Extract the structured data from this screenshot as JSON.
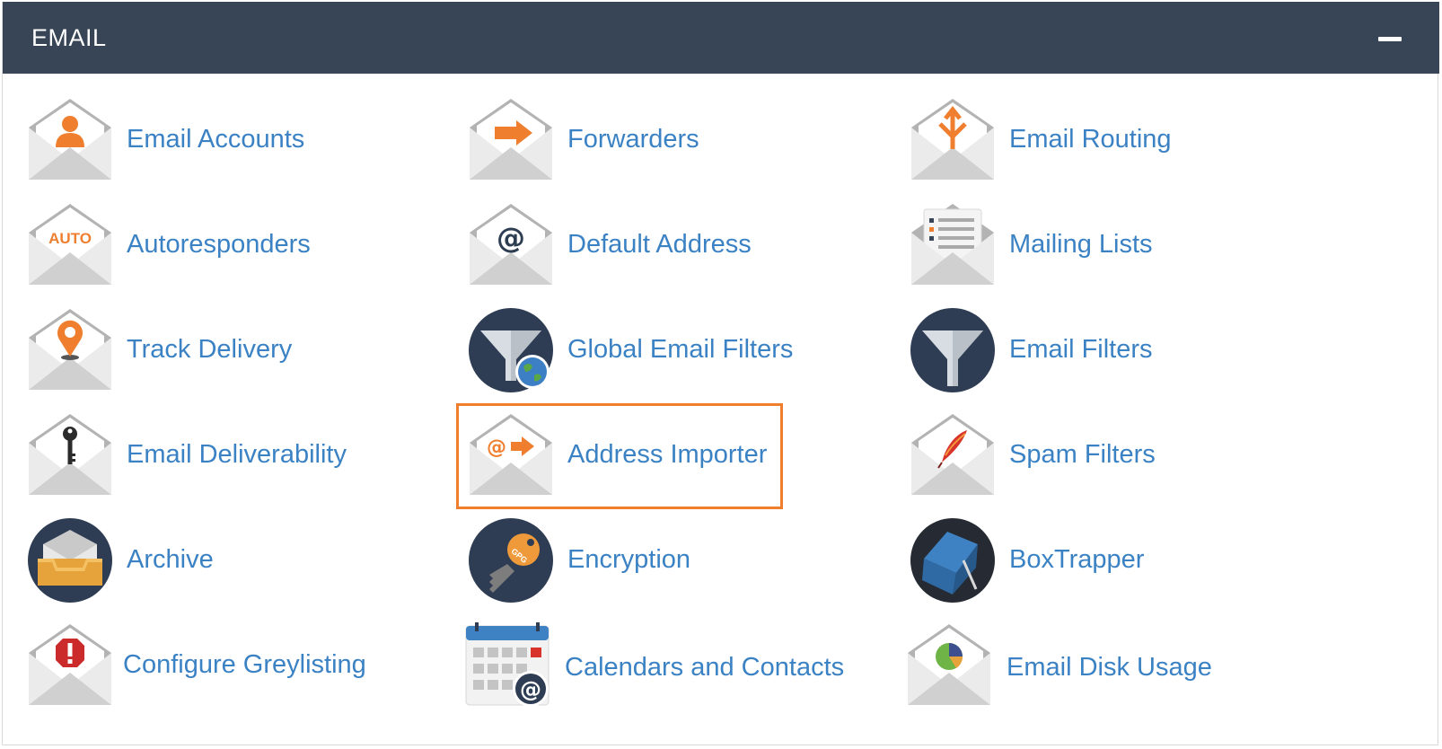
{
  "section": {
    "title": "EMAIL",
    "collapse_icon": "minus-icon"
  },
  "colors": {
    "header_bg": "#374556",
    "link": "#3b82c4",
    "accent_orange": "#ef7f2f",
    "highlight_border": "#ef7f2f"
  },
  "items": [
    {
      "label": "Email Accounts",
      "icon": "envelope-user-icon"
    },
    {
      "label": "Forwarders",
      "icon": "envelope-arrow-icon"
    },
    {
      "label": "Email Routing",
      "icon": "envelope-routing-icon"
    },
    {
      "label": "Autoresponders",
      "icon": "envelope-auto-icon",
      "icon_text": "AUTO"
    },
    {
      "label": "Default Address",
      "icon": "envelope-at-icon"
    },
    {
      "label": "Mailing Lists",
      "icon": "envelope-list-icon"
    },
    {
      "label": "Track Delivery",
      "icon": "envelope-location-pin-icon"
    },
    {
      "label": "Global Email Filters",
      "icon": "funnel-globe-icon"
    },
    {
      "label": "Email Filters",
      "icon": "funnel-icon"
    },
    {
      "label": "Email Deliverability",
      "icon": "envelope-key-icon"
    },
    {
      "label": "Address Importer",
      "icon": "envelope-at-arrow-icon",
      "highlighted": true
    },
    {
      "label": "Spam Filters",
      "icon": "envelope-feather-icon"
    },
    {
      "label": "Archive",
      "icon": "archive-box-icon"
    },
    {
      "label": "Encryption",
      "icon": "gpg-key-icon",
      "icon_text": "GPG"
    },
    {
      "label": "BoxTrapper",
      "icon": "box-trap-icon"
    },
    {
      "label": "Configure Greylisting",
      "icon": "envelope-warning-icon"
    },
    {
      "label": "Calendars and Contacts",
      "icon": "calendar-at-icon"
    },
    {
      "label": "Email Disk Usage",
      "icon": "envelope-pie-chart-icon"
    }
  ]
}
